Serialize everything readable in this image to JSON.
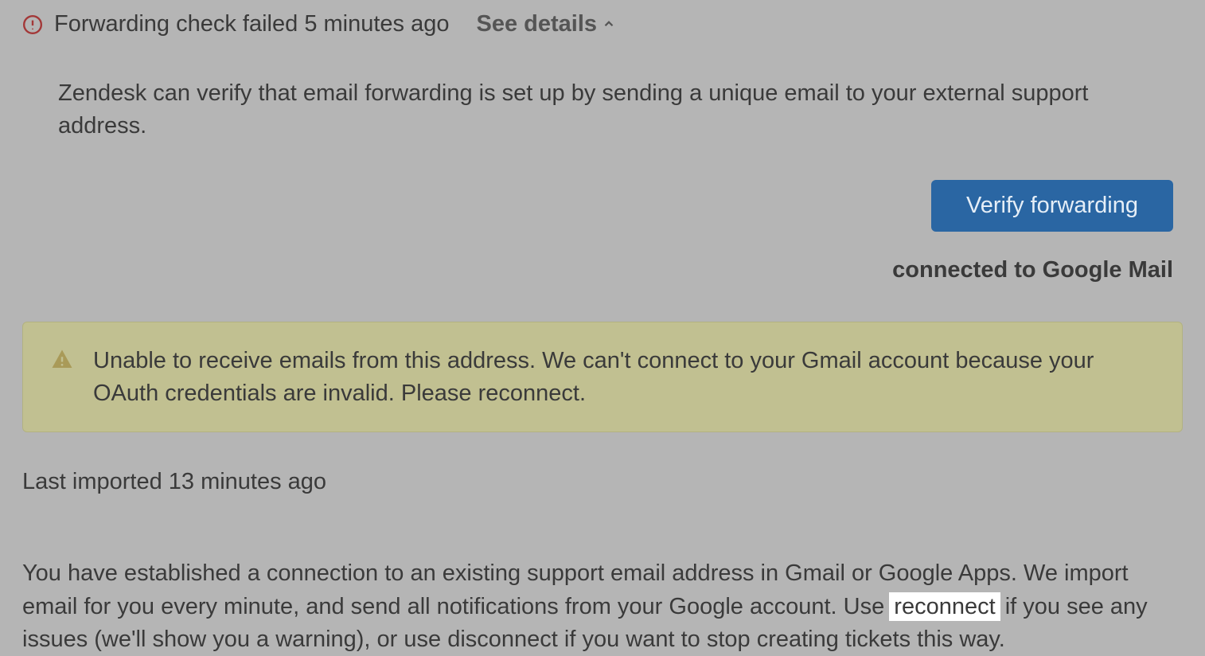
{
  "status": {
    "message": "Forwarding check failed 5 minutes ago",
    "see_details_label": "See details"
  },
  "description": "Zendesk can verify that email forwarding is set up by sending a unique email to your external support address.",
  "verify_button_label": "Verify forwarding",
  "connected_label": "connected to Google Mail",
  "warning": {
    "message": "Unable to receive emails from this address. We can't connect to your Gmail account because your OAuth credentials are invalid. Please reconnect."
  },
  "last_imported": "Last imported 13 minutes ago",
  "footer": {
    "part1": "You have established a connection to an existing support email address in Gmail or Google Apps. We import email for you every minute, and send all notifications from your Google account. Use ",
    "reconnect": "reconnect",
    "part2": " if you see any issues (we'll show you a warning), or use disconnect if you want to stop creating tickets this way."
  },
  "colors": {
    "error_icon": "#a33838",
    "warning_icon": "#a99a58",
    "button_bg": "#2a66a3"
  }
}
